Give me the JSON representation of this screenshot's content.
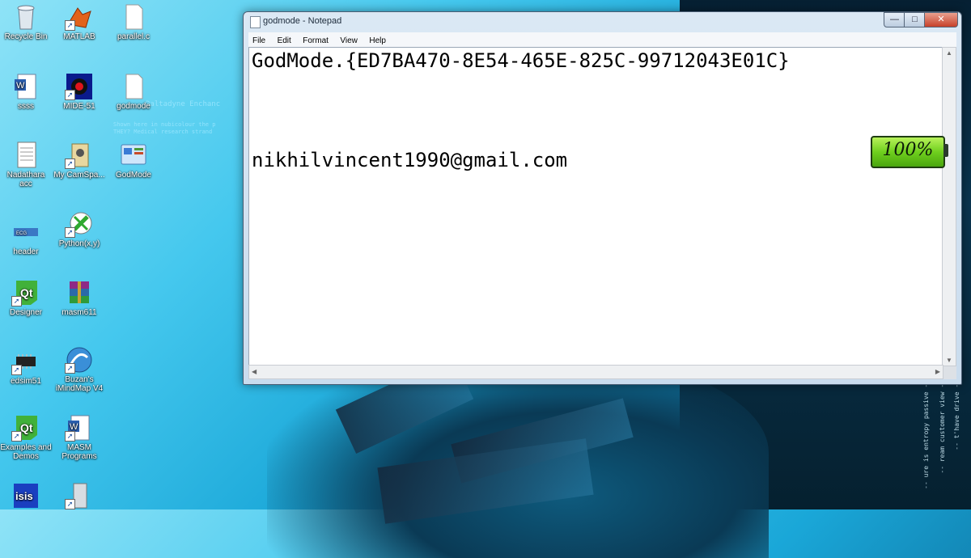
{
  "desktop": {
    "icons": [
      {
        "label": "Recycle Bin",
        "icon": "recycle-bin-icon",
        "shortcut": false
      },
      {
        "label": "MATLAB",
        "icon": "matlab-icon",
        "shortcut": true
      },
      {
        "label": "parallel.c",
        "icon": "text-file-icon",
        "shortcut": false
      },
      {
        "label": "ssss",
        "icon": "word-document-icon",
        "shortcut": false
      },
      {
        "label": "MIDE-51",
        "icon": "mide-icon",
        "shortcut": true
      },
      {
        "label": "godmode",
        "icon": "text-file-icon",
        "shortcut": false
      },
      {
        "label": "Nadathara acc",
        "icon": "spreadsheet-icon",
        "shortcut": false
      },
      {
        "label": "My CamSpa...",
        "icon": "camstudio-icon",
        "shortcut": true
      },
      {
        "label": "GodMode",
        "icon": "control-panel-icon",
        "shortcut": false
      },
      {
        "label": "header",
        "icon": "image-icon",
        "shortcut": false
      },
      {
        "label": "Python(x,y)",
        "icon": "python-xy-icon",
        "shortcut": true
      },
      {
        "label": "Designer",
        "icon": "qt-designer-icon",
        "shortcut": true
      },
      {
        "label": "masm611",
        "icon": "winrar-icon",
        "shortcut": false
      },
      {
        "label": "edsim51",
        "icon": "chip-icon",
        "shortcut": true
      },
      {
        "label": "Buzan's iMindMap V4",
        "icon": "imindmap-icon",
        "shortcut": true
      },
      {
        "label": "Examples and Demos",
        "icon": "qt-icon",
        "shortcut": true
      },
      {
        "label": "MASM Programs",
        "icon": "word-document-icon",
        "shortcut": true
      },
      {
        "label": "",
        "icon": "isis-icon",
        "shortcut": false
      },
      {
        "label": "",
        "icon": "computer-icon",
        "shortcut": true
      }
    ],
    "wallpaper_text": [
      "Daltadyne Enchanc",
      "Shown here in nubicolour the p",
      "THEY? Medical research strand"
    ]
  },
  "notepad": {
    "title": "godmode - Notepad",
    "menu": [
      "File",
      "Edit",
      "Format",
      "View",
      "Help"
    ],
    "lines": [
      "GodMode.{ED7BA470-8E54-465E-825C-99712043E01C}",
      "",
      "",
      "nikhilvincent1990@gmail.com"
    ]
  },
  "battery": {
    "level_percent": 100,
    "label": "100%"
  },
  "colors": {
    "title_bar": "#c9dcee",
    "close_button": "#c7412a",
    "battery_fill": "#6fcf1e"
  }
}
